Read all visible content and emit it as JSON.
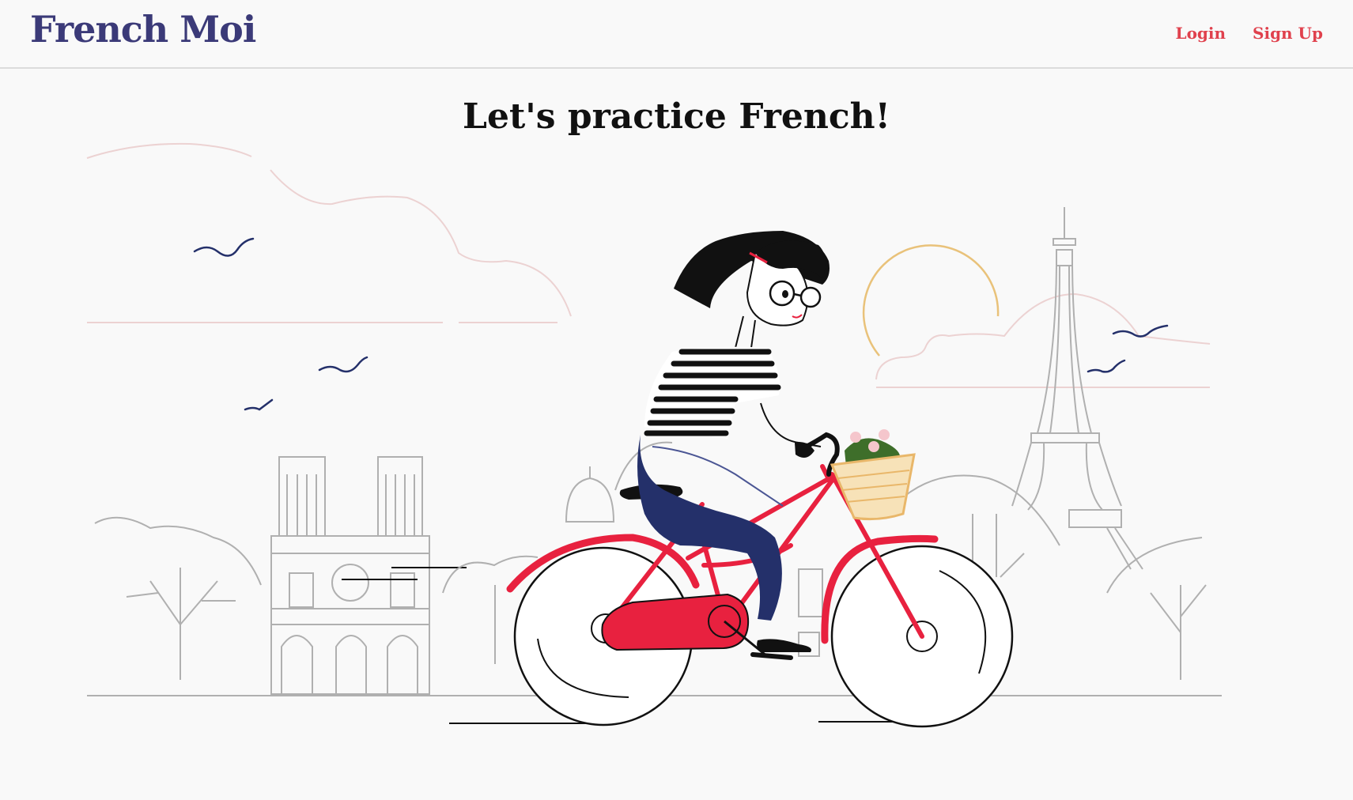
{
  "header": {
    "logo_text": "French Moi",
    "nav": {
      "login_label": "Login",
      "signup_label": "Sign Up"
    }
  },
  "hero": {
    "title": "Let's practice French!",
    "illustration": "woman-riding-bicycle-paris-icon"
  },
  "colors": {
    "brand": "#3b3a78",
    "accent": "#e0414d",
    "bike_red": "#e8213f",
    "jeans": "#24306a",
    "sun": "#e9c27a",
    "cloud": "#ecd2d2",
    "outline": "#b0b0b0"
  }
}
